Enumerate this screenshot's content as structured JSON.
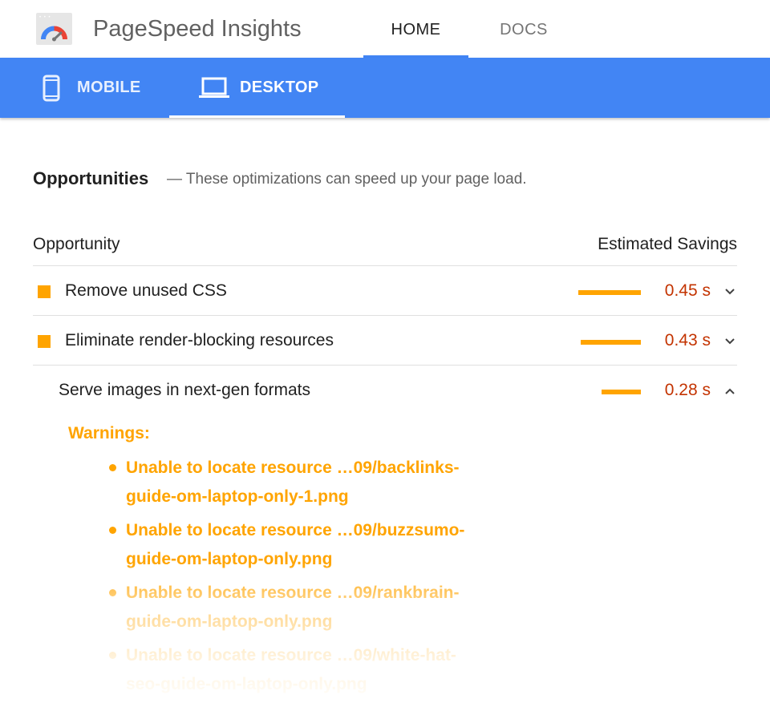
{
  "header": {
    "app_title": "PageSpeed Insights",
    "logo_icon": "pagespeed-gauge-icon",
    "nav": [
      {
        "label": "HOME",
        "active": true
      },
      {
        "label": "DOCS",
        "active": false
      }
    ]
  },
  "device_tabs": [
    {
      "label": "MOBILE",
      "icon": "smartphone-icon",
      "active": false
    },
    {
      "label": "DESKTOP",
      "icon": "laptop-icon",
      "active": true
    }
  ],
  "opportunities": {
    "title": "Opportunities",
    "description": "— These optimizations can speed up your page load.",
    "column_opportunity": "Opportunity",
    "column_savings": "Estimated Savings",
    "rows": [
      {
        "title": "Remove unused CSS",
        "savings": "0.45 s",
        "savings_value": 0.45,
        "expanded": false
      },
      {
        "title": "Eliminate render-blocking resources",
        "savings": "0.43 s",
        "savings_value": 0.43,
        "expanded": false
      },
      {
        "title": "Serve images in next-gen formats",
        "savings": "0.28 s",
        "savings_value": 0.28,
        "expanded": true
      }
    ],
    "warnings_label": "Warnings:",
    "warnings": [
      {
        "line1": "Unable to locate resource …09/backlinks-",
        "line2": "guide-om-laptop-only-1.png"
      },
      {
        "line1": "Unable to locate resource …09/buzzsumo-",
        "line2": "guide-om-laptop-only.png"
      },
      {
        "line1": "Unable to locate resource …09/rankbrain-",
        "line2": "guide-om-laptop-only.png"
      },
      {
        "line1": "Unable to locate resource …09/white-hat-",
        "line2": "seo-guide-om-laptop-only.png"
      }
    ]
  },
  "colors": {
    "brand_blue": "#4285f4",
    "warning_orange": "#ffa400",
    "savings_red": "#c33300"
  }
}
